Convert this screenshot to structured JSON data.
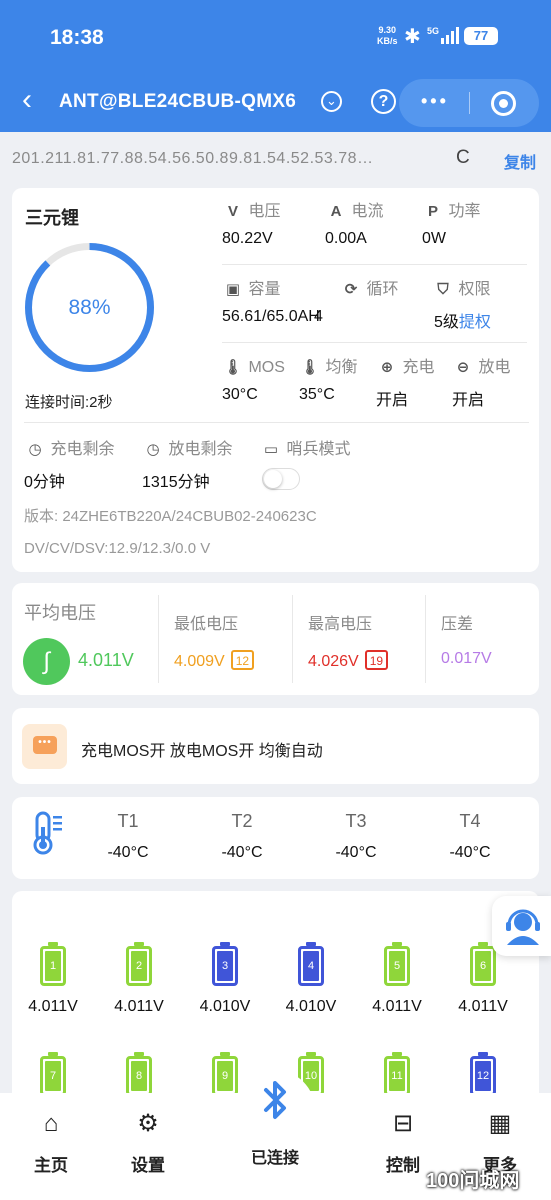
{
  "status": {
    "time": "18:38",
    "net_speed": "9.30",
    "net_unit": "KB/s",
    "bt_symbol": "✱",
    "signal": "5G",
    "battery": "77"
  },
  "nav": {
    "back": "‹",
    "title": "ANT@BLE24CBUB-QMX6",
    "help": "?",
    "more_dots": "•••"
  },
  "address": {
    "text": "201.211.81.77.88.54.56.50.89.81.54.52.53.78…",
    "refresh": "C",
    "copy_label": "复制"
  },
  "main": {
    "battery_type": "三元锂",
    "soc_percent": 88,
    "soc_label": "88%",
    "connect_time": "连接时间:2秒",
    "voltage": {
      "icon": "V",
      "label": "电压",
      "value": "80.22V"
    },
    "current": {
      "icon": "A",
      "label": "电流",
      "value": "0.00A"
    },
    "power": {
      "icon": "P",
      "label": "功率",
      "value": "0W"
    },
    "capacity": {
      "icon": "▣",
      "label": "容量",
      "value": "56.61/65.0AH"
    },
    "cycle": {
      "icon": "⟳",
      "label": "循环",
      "value": "4"
    },
    "permission": {
      "icon": "⛉",
      "label": "权限",
      "value": "5级",
      "link": "提权"
    },
    "mos": {
      "icon": "🌡",
      "label": "MOS",
      "value": "30°C"
    },
    "balance": {
      "icon": "🌡",
      "label": "均衡",
      "value": "35°C"
    },
    "charge": {
      "icon": "⊕",
      "label": "充电",
      "value": "开启"
    },
    "discharge": {
      "icon": "⊖",
      "label": "放电",
      "value": "开启"
    },
    "charge_remain": {
      "icon": "◷",
      "label": "充电剩余",
      "value": "0分钟"
    },
    "discharge_remain": {
      "icon": "◷",
      "label": "放电剩余",
      "value": "1315分钟"
    },
    "sentinel": {
      "icon": "▭",
      "label": "哨兵模式",
      "enabled": false
    },
    "version": "版本: 24ZHE6TB220A/24CBUB02-240623C",
    "dvcv": "DV/CV/DSV:12.9/12.3/0.0 V"
  },
  "volt_summary": {
    "avg": {
      "label": "平均电压",
      "value": "4.011V",
      "icon": "∫"
    },
    "min": {
      "label": "最低电压",
      "value": "4.009V",
      "cell": "12"
    },
    "max": {
      "label": "最高电压",
      "value": "4.026V",
      "cell": "19"
    },
    "diff": {
      "label": "压差",
      "value": "0.017V"
    },
    "colors": {
      "avg": "#50c85c",
      "min": "#f0a020",
      "max": "#e0302a",
      "diff": "#b67be6"
    }
  },
  "mos_status": {
    "icon": "•••",
    "text": "充电MOS开  放电MOS开  均衡自动"
  },
  "temps": [
    {
      "label": "T1",
      "value": "-40°C"
    },
    {
      "label": "T2",
      "value": "-40°C"
    },
    {
      "label": "T3",
      "value": "-40°C"
    },
    {
      "label": "T4",
      "value": "-40°C"
    }
  ],
  "cells": [
    {
      "index": "1",
      "voltage": "4.011V",
      "color": "#8fd63a"
    },
    {
      "index": "2",
      "voltage": "4.011V",
      "color": "#8fd63a"
    },
    {
      "index": "3",
      "voltage": "4.010V",
      "color": "#4055d8"
    },
    {
      "index": "4",
      "voltage": "4.010V",
      "color": "#4055d8"
    },
    {
      "index": "5",
      "voltage": "4.011V",
      "color": "#8fd63a"
    },
    {
      "index": "6",
      "voltage": "4.011V",
      "color": "#8fd63a"
    },
    {
      "index": "7",
      "voltage": "",
      "color": "#8fd63a"
    },
    {
      "index": "8",
      "voltage": "",
      "color": "#8fd63a"
    },
    {
      "index": "9",
      "voltage": "",
      "color": "#8fd63a"
    },
    {
      "index": "10",
      "voltage": "",
      "color": "#8fd63a"
    },
    {
      "index": "11",
      "voltage": "",
      "color": "#8fd63a"
    },
    {
      "index": "12",
      "voltage": "",
      "color": "#4055d8"
    }
  ],
  "tabs": [
    {
      "name": "home",
      "icon": "⌂",
      "label": "主页"
    },
    {
      "name": "settings",
      "icon": "⚙",
      "label": "设置"
    },
    {
      "name": "control",
      "icon": "⊟",
      "label": "控制"
    },
    {
      "name": "more",
      "icon": "▦",
      "label": "更多"
    }
  ],
  "bluetooth": {
    "symbol": "✱",
    "label": "已连接"
  },
  "watermark": "100问城网",
  "colors": {
    "brand": "#3d85e8",
    "background": "#eef0f4"
  }
}
